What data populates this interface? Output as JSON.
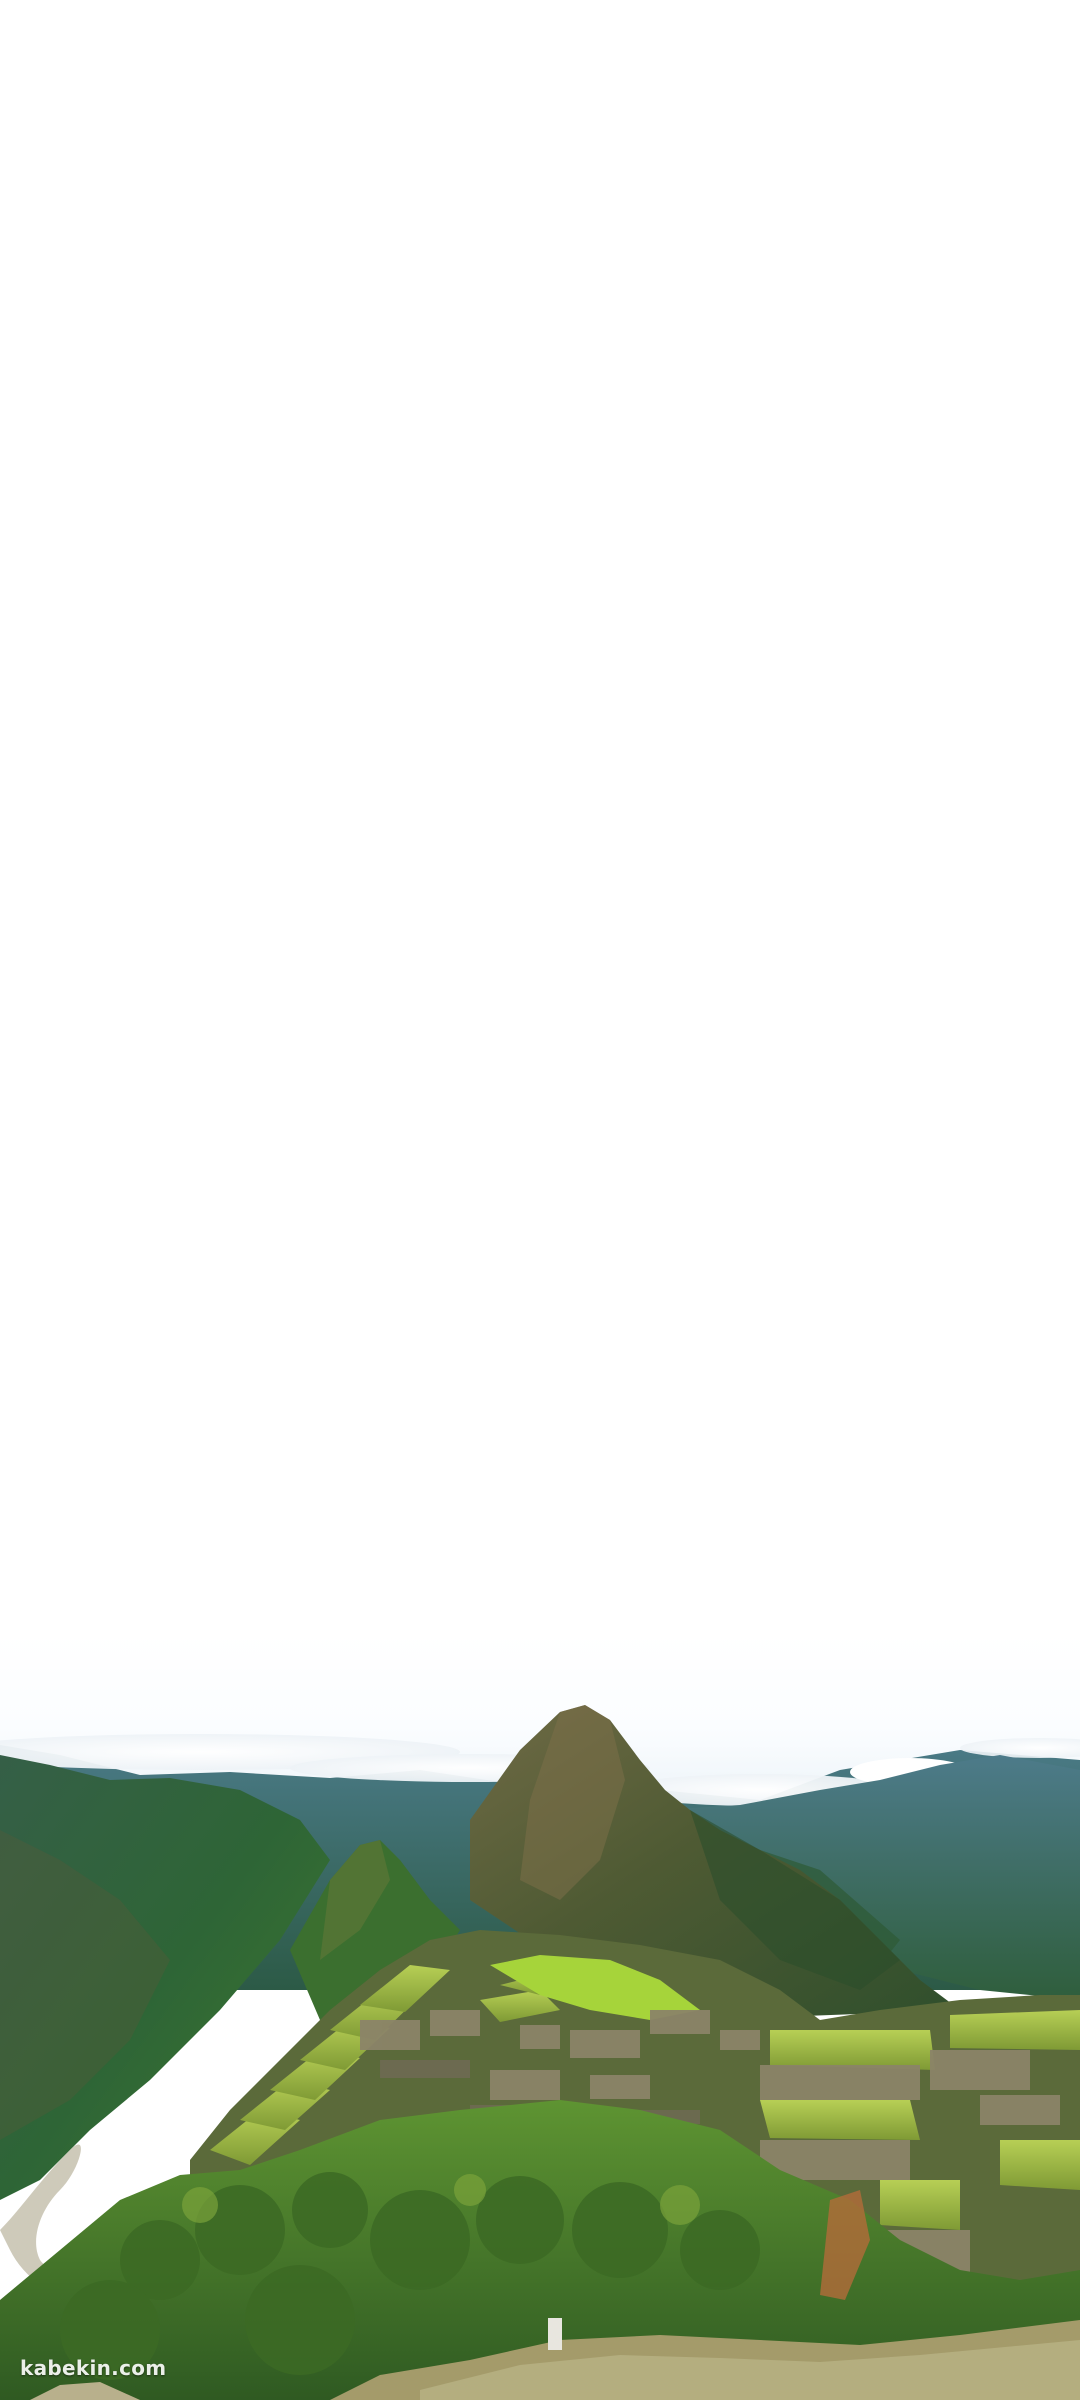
{
  "image": {
    "description_type": "wallpaper-photo",
    "colors": {
      "sky": "#ffffff",
      "cloud": "#f3f6f9",
      "far_ridge": "#3e6b78",
      "ridge_green": "#2f6b3a",
      "peak_rock": "#5d5a3c",
      "terrace_grass": "#a7c244",
      "terrace_stone": "#8b8468",
      "foreground_green": "#4f8a2e",
      "river": "#c9c4b2"
    }
  },
  "watermark": {
    "text": "kabekin.com"
  }
}
